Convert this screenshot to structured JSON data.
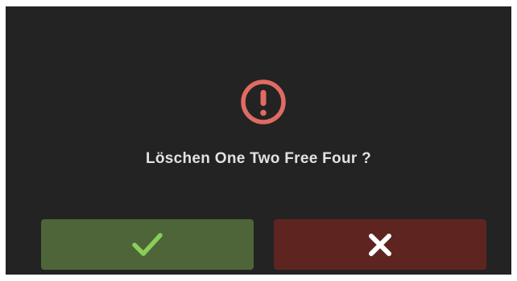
{
  "dialog": {
    "icon": "exclamation-circle-icon",
    "message": "Löschen One Two Free Four ?",
    "confirm_icon": "checkmark-icon",
    "cancel_icon": "close-icon"
  },
  "colors": {
    "background": "#232323",
    "warning": "#e06b62",
    "message_text": "#e2e2e2",
    "confirm_button": "#4d6539",
    "confirm_icon": "#8ccd57",
    "cancel_button": "#5e2520",
    "cancel_icon": "#ffffff"
  }
}
